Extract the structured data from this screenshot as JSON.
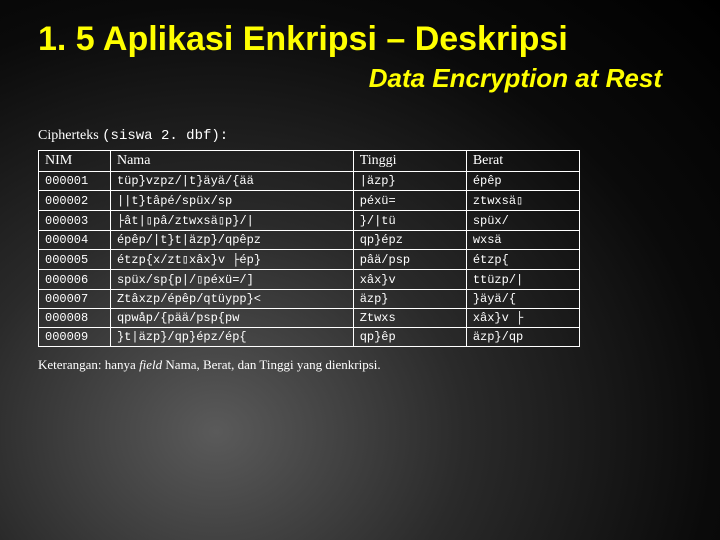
{
  "title": "1. 5 Aplikasi Enkripsi – Deskripsi",
  "subtitle": "Data Encryption at Rest",
  "caption_prefix": "Cipherteks",
  "caption_suffix": "(siswa 2. dbf):",
  "columns": [
    "NIM",
    "Nama",
    "Tinggi",
    "Berat"
  ],
  "rows": [
    {
      "nim": "000001",
      "nama": "tüp}vzpz/|t}äyä/{ää",
      "tinggi": "|äzp}",
      "berat": "épêp"
    },
    {
      "nim": "000002",
      "nama": "||t}tâpé/spüx/sp",
      "tinggi": "péxü=",
      "berat": "ztwxsä▯"
    },
    {
      "nim": "000003",
      "nama": "├ât|▯pâ/ztwxsä▯p}/|",
      "tinggi": "}/|tü",
      "berat": "spüx/"
    },
    {
      "nim": "000004",
      "nama": "épêp/|t}t|äzp}/qpêpz",
      "tinggi": "qp}épz",
      "berat": "wxsä"
    },
    {
      "nim": "000005",
      "nama": "étzp{x/zt▯xâx}v ├ép}",
      "tinggi": "pâä/psp",
      "berat": "étzp{"
    },
    {
      "nim": "000006",
      "nama": "spüx/sp{p|/▯péxü=/]",
      "tinggi": "xâx}v",
      "berat": "ttüzp/|"
    },
    {
      "nim": "000007",
      "nama": "Ztâxzp/épêp/qtüypp}<",
      "tinggi": "äzp}",
      "berat": "}äyä/{"
    },
    {
      "nim": "000008",
      "nama": "qpwåp/{pää/psp{pw",
      "tinggi": "Ztwxs",
      "berat": "xâx}v ├"
    },
    {
      "nim": "000009",
      "nama": "}t|äzp}/qp}épz/ép{",
      "tinggi": "qp}êp",
      "berat": "äzp}/qp"
    }
  ],
  "footnote_prefix": "Keterangan: hanya ",
  "footnote_italic": "field",
  "footnote_suffix": " Nama, Berat, dan Tinggi yang dienkripsi."
}
